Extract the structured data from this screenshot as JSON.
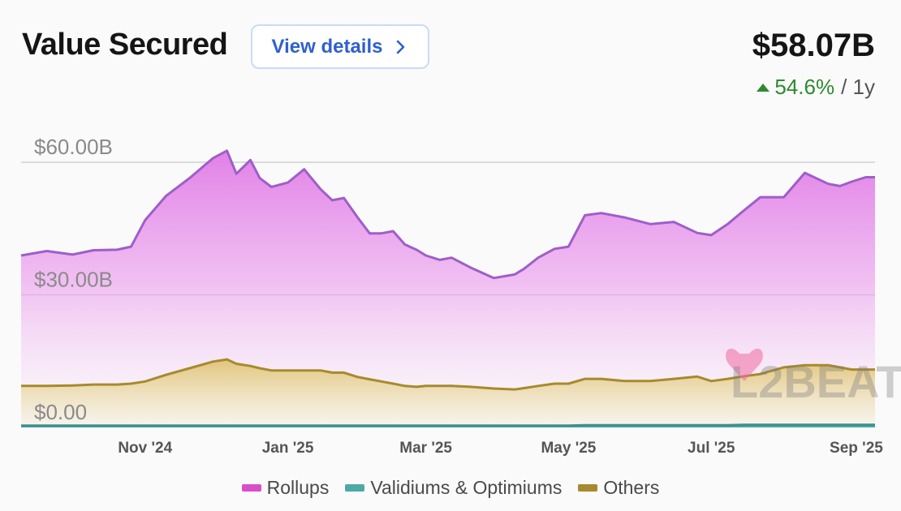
{
  "header": {
    "title": "Value Secured",
    "details_label": "View details",
    "total": "$58.07B",
    "change": "54.6%",
    "period": "/ 1y"
  },
  "colors": {
    "rollups": "#d94fc8",
    "validiums": "#4ea8a6",
    "others": "#a78a2c",
    "change_positive": "#2f8a2f",
    "button_text": "#2f5fd0"
  },
  "watermark": "L2BEAT",
  "chart_data": {
    "type": "area",
    "y_ticks": [
      "$60.00B",
      "$30.00B",
      "$0.00"
    ],
    "y_tick_values": [
      60,
      30,
      0
    ],
    "ylim": [
      0,
      60
    ],
    "x_tick_labels": [
      "Nov '24",
      "Jan '25",
      "Mar '25",
      "May '25",
      "Jul '25",
      "Sep '25"
    ],
    "x_tick_dates": [
      "2024-11-01",
      "2025-01-01",
      "2025-03-01",
      "2025-05-01",
      "2025-07-01",
      "2025-09-01"
    ],
    "x_range": [
      "2024-09-09",
      "2025-09-09"
    ],
    "grid": true,
    "stacked": true,
    "legend_position": "bottom",
    "x": [
      "2024-09-09",
      "2024-09-20",
      "2024-10-01",
      "2024-10-10",
      "2024-10-20",
      "2024-10-26",
      "2024-11-01",
      "2024-11-10",
      "2024-11-20",
      "2024-11-30",
      "2024-12-06",
      "2024-12-10",
      "2024-12-16",
      "2024-12-20",
      "2024-12-25",
      "2025-01-01",
      "2025-01-08",
      "2025-01-15",
      "2025-01-20",
      "2025-01-25",
      "2025-01-31",
      "2025-02-05",
      "2025-02-10",
      "2025-02-15",
      "2025-02-20",
      "2025-02-25",
      "2025-03-01",
      "2025-03-07",
      "2025-03-12",
      "2025-03-20",
      "2025-03-30",
      "2025-04-08",
      "2025-04-12",
      "2025-04-18",
      "2025-04-25",
      "2025-05-01",
      "2025-05-08",
      "2025-05-15",
      "2025-05-25",
      "2025-06-05",
      "2025-06-15",
      "2025-06-25",
      "2025-07-01",
      "2025-07-08",
      "2025-07-15",
      "2025-07-22",
      "2025-08-01",
      "2025-08-10",
      "2025-08-20",
      "2025-08-25",
      "2025-08-30",
      "2025-09-05",
      "2025-09-09"
    ],
    "series": [
      {
        "name": "Rollups",
        "values": [
          29.5,
          30.5,
          29.6,
          30.4,
          30.5,
          31.0,
          36.5,
          40.5,
          43.0,
          46.0,
          47.2,
          43.0,
          46.6,
          43.0,
          41.5,
          42.5,
          45.5,
          41.0,
          39.0,
          39.5,
          36.0,
          33.0,
          33.5,
          34.5,
          32.0,
          31.0,
          29.5,
          28.5,
          29.0,
          27.0,
          25.0,
          26.0,
          27.0,
          29.0,
          30.5,
          31.0,
          37.0,
          37.5,
          37.0,
          35.5,
          35.5,
          32.5,
          33.0,
          35.0,
          37.5,
          40.0,
          38.5,
          43.5,
          41.0,
          41.0,
          42.5,
          43.5,
          43.5
        ]
      },
      {
        "name": "Validiums & Optimiums",
        "values": [
          0.4,
          0.4,
          0.4,
          0.4,
          0.4,
          0.4,
          0.4,
          0.4,
          0.4,
          0.4,
          0.4,
          0.4,
          0.4,
          0.4,
          0.4,
          0.4,
          0.4,
          0.4,
          0.4,
          0.4,
          0.4,
          0.4,
          0.4,
          0.4,
          0.4,
          0.4,
          0.4,
          0.4,
          0.4,
          0.4,
          0.4,
          0.4,
          0.4,
          0.4,
          0.4,
          0.4,
          0.5,
          0.5,
          0.5,
          0.5,
          0.5,
          0.5,
          0.5,
          0.5,
          0.6,
          0.6,
          0.6,
          0.6,
          0.6,
          0.6,
          0.6,
          0.6,
          0.6
        ]
      },
      {
        "name": "Others",
        "values": [
          9.0,
          9.0,
          9.1,
          9.3,
          9.3,
          9.5,
          10.0,
          11.5,
          13.0,
          14.5,
          15.0,
          14.0,
          13.5,
          13.0,
          12.5,
          12.5,
          12.5,
          12.5,
          12.0,
          12.0,
          11.0,
          10.5,
          10.0,
          9.5,
          9.0,
          8.8,
          9.0,
          9.0,
          9.0,
          8.8,
          8.4,
          8.2,
          8.5,
          9.0,
          9.5,
          9.5,
          10.5,
          10.5,
          10.0,
          10.0,
          10.5,
          11.0,
          10.0,
          10.5,
          11.0,
          11.5,
          13.0,
          13.5,
          13.5,
          13.0,
          12.5,
          12.5,
          12.5
        ]
      }
    ]
  }
}
